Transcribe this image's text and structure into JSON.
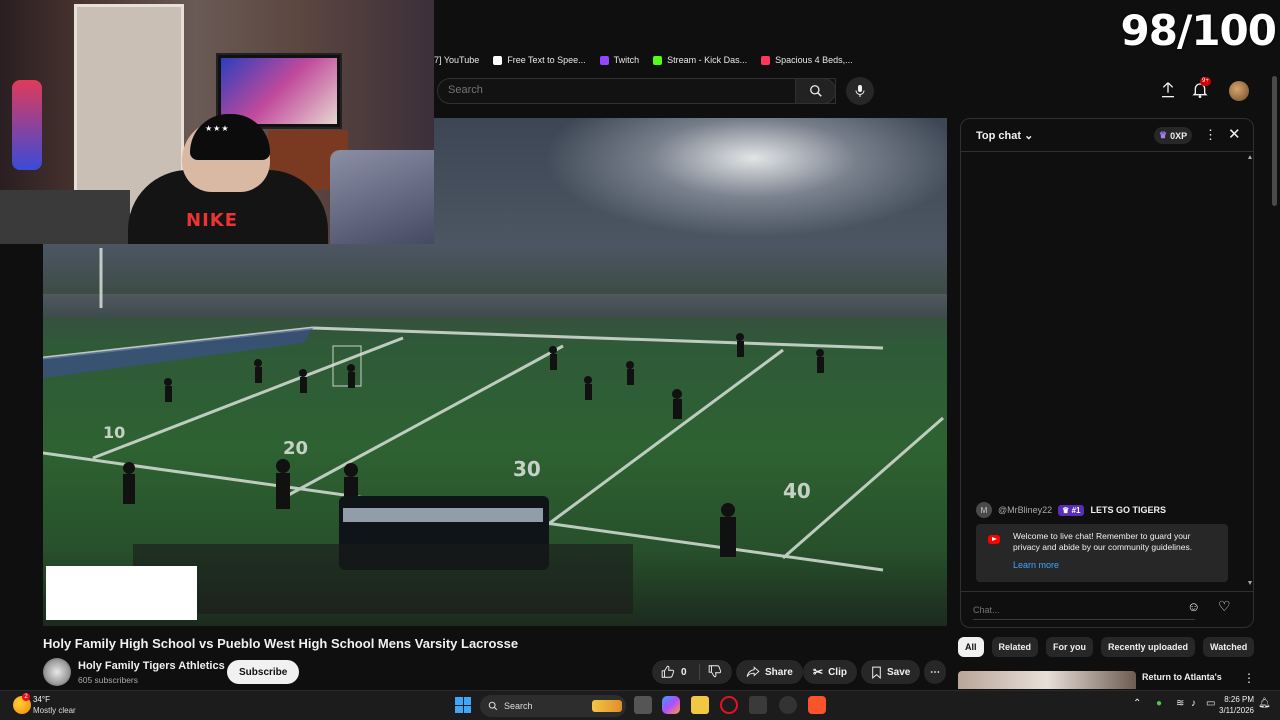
{
  "score_overlay": "98/100",
  "bookmarks": [
    {
      "label": "7] YouTube",
      "icon": "youtube-bookmark-icon",
      "color": "#e33"
    },
    {
      "label": "Free Text to Spee...",
      "icon": "document-bookmark-icon",
      "color": "#ffffff"
    },
    {
      "label": "Twitch",
      "icon": "twitch-icon",
      "color": "#9146ff"
    },
    {
      "label": "Stream - Kick Das...",
      "icon": "kick-icon",
      "color": "#53fc18"
    },
    {
      "label": "Spacious 4 Beds,...",
      "icon": "airbnb-icon",
      "color": "#ff385c"
    }
  ],
  "search": {
    "placeholder": "Search"
  },
  "header": {
    "notifications_badge": "9+"
  },
  "video": {
    "title": "Holy Family High School vs Pueblo West High School Mens Varsity Lacrosse",
    "channel": "Holy Family Tigers Athletics",
    "subscribers": "605 subscribers",
    "subscribe_label": "Subscribe",
    "like_count": "0",
    "share_label": "Share",
    "clip_label": "Clip",
    "save_label": "Save",
    "field_numbers": [
      "10",
      "20",
      "30",
      "40"
    ]
  },
  "chat": {
    "title": "Top chat",
    "xp": "0XP",
    "message": {
      "avatar_letter": "M",
      "author": "@MrBliney22",
      "badge": "#1",
      "text": "LETS GO TIGERS"
    },
    "welcome_text": "Welcome to live chat! Remember to guard your privacy and abide by our community guidelines.",
    "learn_more": "Learn more",
    "input_placeholder": "Chat..."
  },
  "chips": [
    {
      "label": "All",
      "active": true
    },
    {
      "label": "Related",
      "active": false
    },
    {
      "label": "For you",
      "active": false
    },
    {
      "label": "Recently uploaded",
      "active": false
    },
    {
      "label": "Watched",
      "active": false
    }
  ],
  "related": {
    "title": "Return to Atlanta's"
  },
  "taskbar": {
    "temperature": "34°F",
    "condition": "Mostly clear",
    "weather_badge": "2",
    "search_label": "Search",
    "time": "8:26 PM",
    "date": "3/11/2026"
  }
}
